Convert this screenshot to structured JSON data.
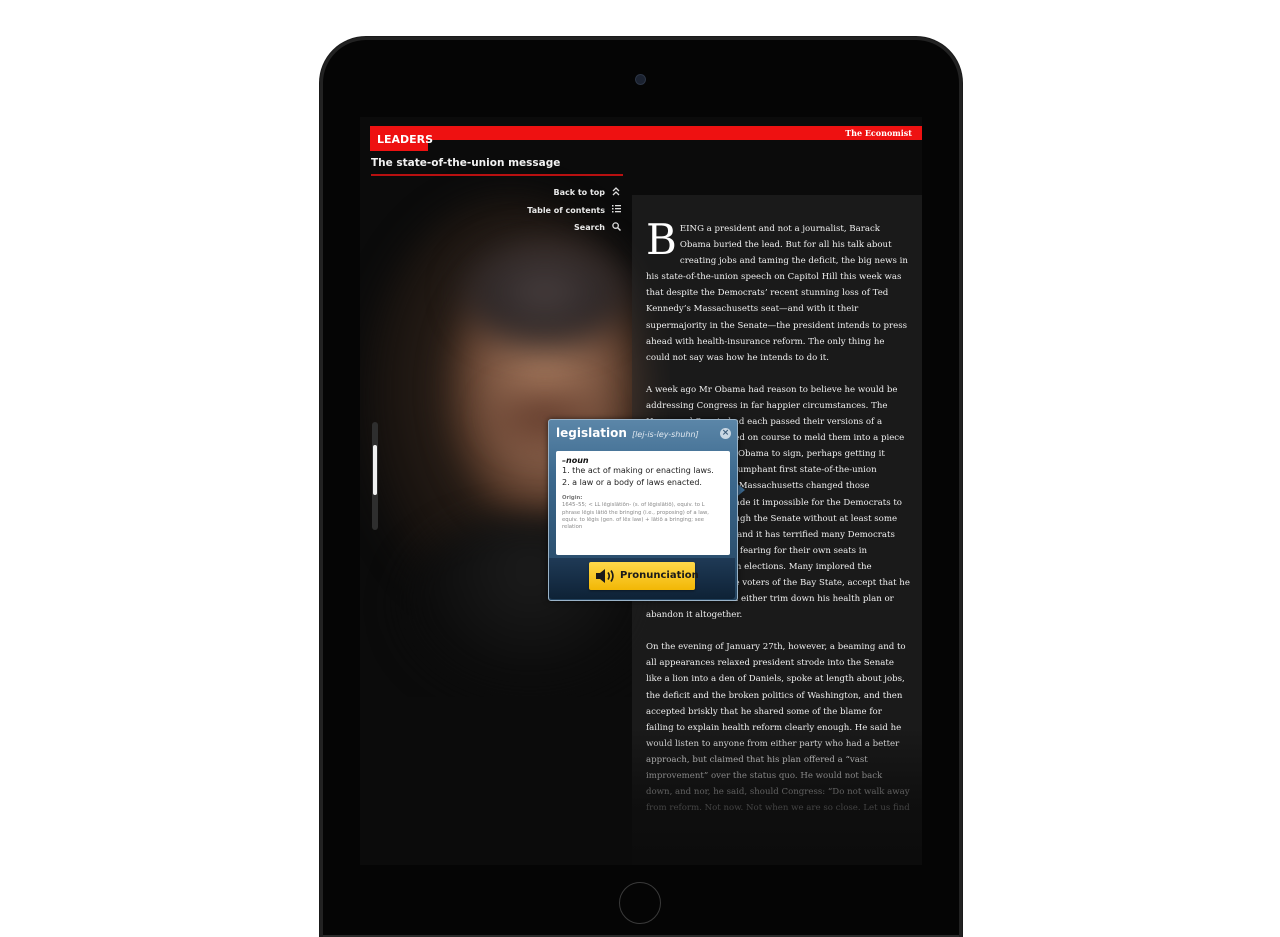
{
  "app": {
    "section": "LEADERS",
    "brand": "The Economist",
    "headline": "The state-of-the-union message"
  },
  "nav": {
    "back_to_top": "Back to top",
    "table_of_contents": "Table of contents",
    "search": "Search"
  },
  "article": {
    "dropcap": "B",
    "p1": "EING a president and not a journalist, Barack Obama buried the lead. But for all his talk about creating jobs and taming the deficit, the big news in his state-of-the-union speech on Capitol Hill this week was that despite the Democrats’ recent stunning loss of Ted Kennedy’s Massachusetts seat—and with it their supermajority in the Senate—the president intends to press ahead with health-insurance reform. The only thing he could not say was how he intends to do it.",
    "p2_before": "A week ago Mr Obama had reason to believe he would be addressing Congress in far happier circumstances. The House and Senate had each passed their versions of a health bill and seemed on course to meld them into a piece of ",
    "p2_highlight": "legislation",
    "p2_after": " for Mr Obama to sign, perhaps getting it away in time for a triumphant first state-of-the-union speech. The upset in Massachusetts changed those calculation. It has made it impossible for the Democrats to force a new bill through the Senate without at least some Republican support; and it has terrified many Democrats who are now already fearing for their own seats in November’s mid-term elections. Many implored the president to heed the voters of the Bay State, accept that he had overreached and either trim down his health plan or abandon it altogether.",
    "p3": "On the evening of January 27th, however, a beaming and to all appearances relaxed president strode into the Senate like a lion into a den of Daniels, spoke at length about jobs, the deficit and the broken politics of Washington, and then accepted briskly that he shared some of the blame for failing to explain health reform clearly enough. He said he would listen to anyone from either party who had a better approach, but claimed that his plan offered a “vast improvement” over the status quo. He would not back down, and nor, he said, should Congress: “Do not walk away from reform. Not now. Not when we are so close. Let us find"
  },
  "dictionary": {
    "word": "legislation",
    "pronunciation": "[lej-is-ley-shuhn]",
    "part_of_speech": "–noun",
    "definitions": [
      "1.  the act of making or enacting laws.",
      "2.  a law or a body of laws enacted."
    ],
    "origin_label": "Origin:",
    "origin_text": "1645–55; < LL lēgislātiōn- (s. of lēgislātiō), equiv. to L phrase lēgis lātiō the bringing (i.e., proposing) of a law, equiv. to lēgis (gen. of lēx law) + lātiō a bringing; see relation",
    "close": "×",
    "pronunciation_button": "Pronunciation"
  },
  "icons": {
    "back_to_top": "double-chevron-up-icon",
    "table_of_contents": "list-icon",
    "search": "magnifier-icon",
    "close": "close-icon",
    "speaker": "speaker-icon"
  },
  "colors": {
    "accent_red": "#ee1111",
    "popover_blue": "#3d6a8f",
    "button_yellow": "#f2b705",
    "highlight": "#3d5878"
  }
}
